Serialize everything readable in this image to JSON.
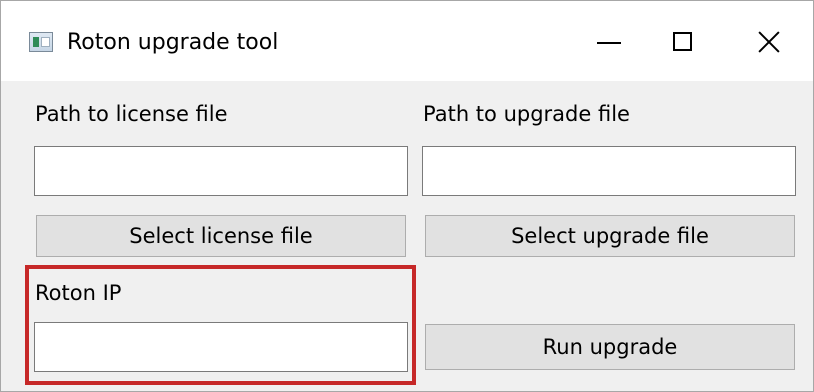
{
  "window": {
    "title": "Roton upgrade tool",
    "controls": {
      "minimize": "minimize",
      "maximize": "maximize",
      "close": "close"
    }
  },
  "form": {
    "license_label": "Path to license file",
    "license_value": "",
    "upgrade_label": "Path to upgrade file",
    "upgrade_value": "",
    "select_license_button": "Select license file",
    "select_upgrade_button": "Select upgrade file",
    "ip_label": "Roton IP",
    "ip_value": "",
    "run_button": "Run upgrade"
  },
  "colors": {
    "highlight": "#c62828",
    "button_bg": "#e1e1e1",
    "window_bg": "#f0f0f0"
  }
}
